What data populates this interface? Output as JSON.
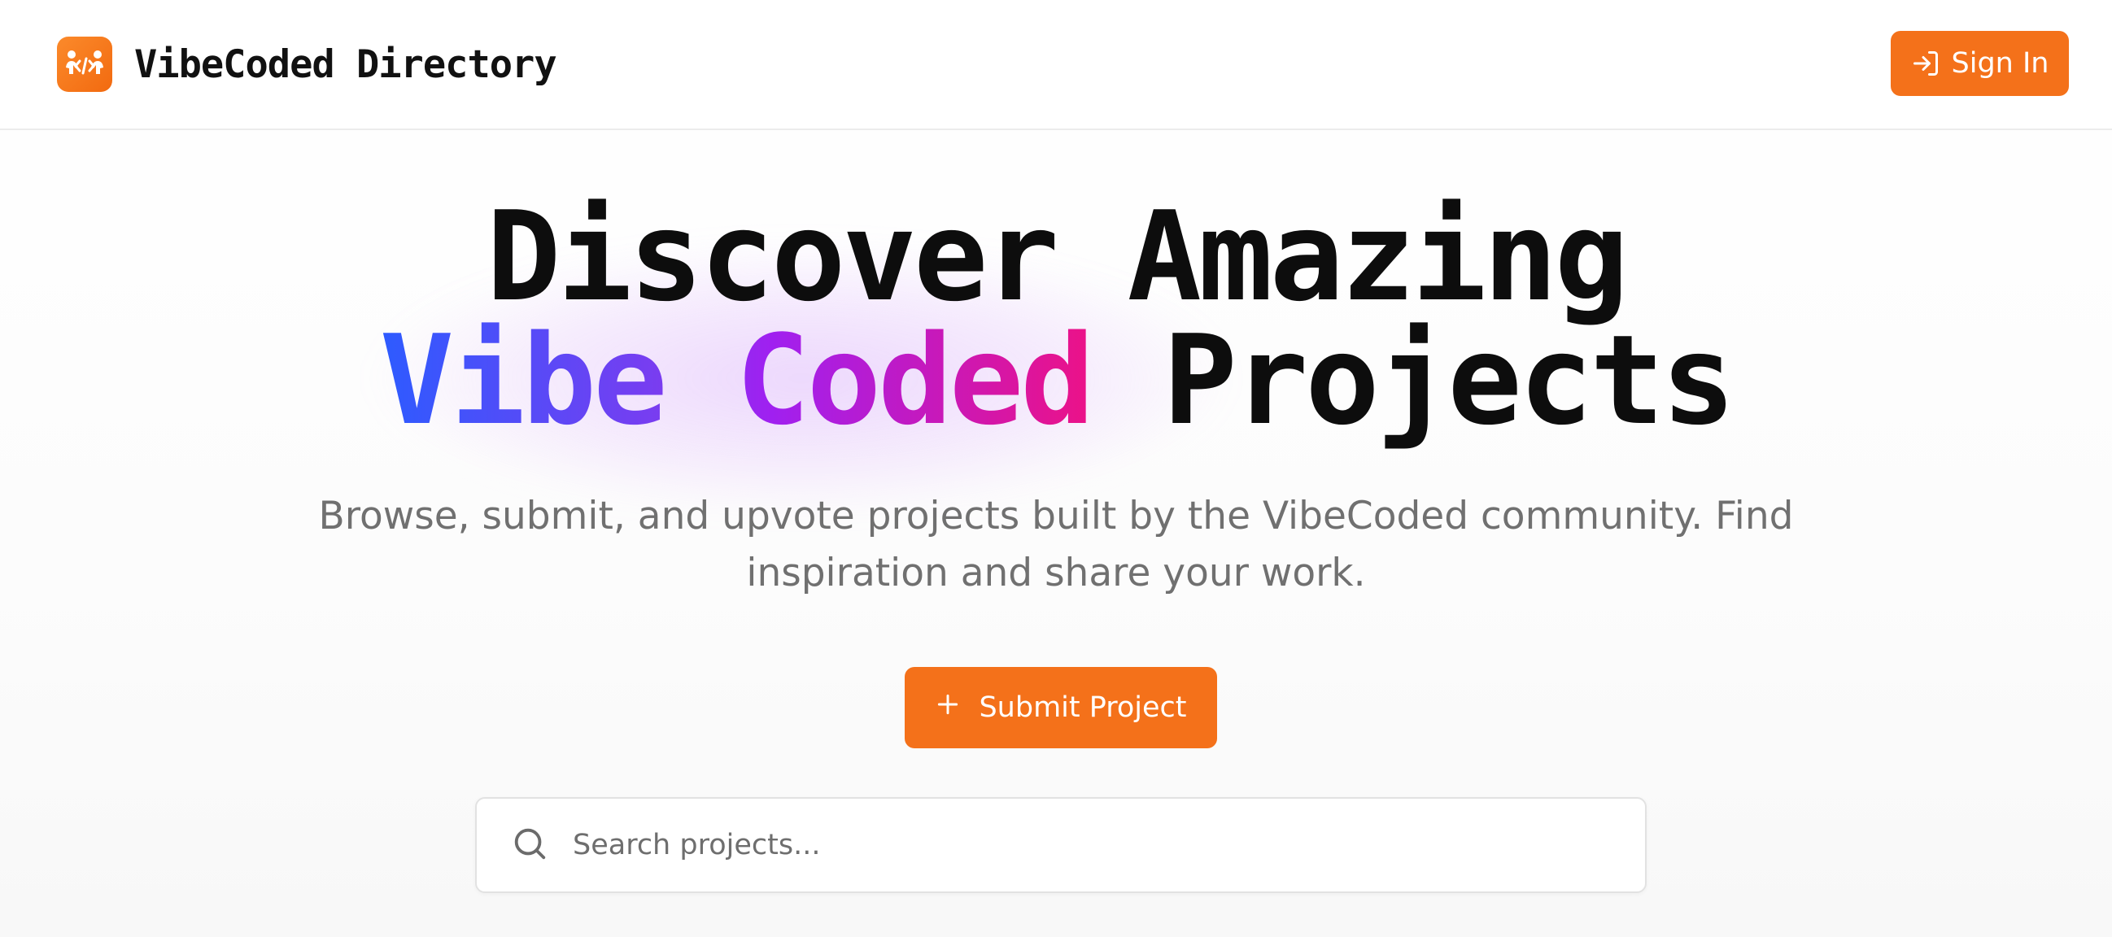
{
  "header": {
    "brand_name": "VibeCoded Directory",
    "brand_icon": "code-people-icon",
    "signin_label": "Sign In",
    "signin_icon": "sign-in-icon"
  },
  "hero": {
    "line1": "Discover Amazing",
    "line2_highlight": "Vibe Coded",
    "line2_rest": "Projects",
    "subtitle": "Browse, submit, and upvote projects built by the VibeCoded community. Find inspiration and share your work."
  },
  "actions": {
    "submit_label": "Submit Project",
    "submit_icon": "plus-icon"
  },
  "search": {
    "placeholder": "Search projects...",
    "value": "",
    "icon": "search-icon"
  },
  "colors": {
    "accent": "#f4711a",
    "gradient_start": "#2d5bff",
    "gradient_mid": "#a020f0",
    "gradient_end": "#ec1287",
    "heading": "#0d0d0d",
    "subtitle": "#707070"
  }
}
